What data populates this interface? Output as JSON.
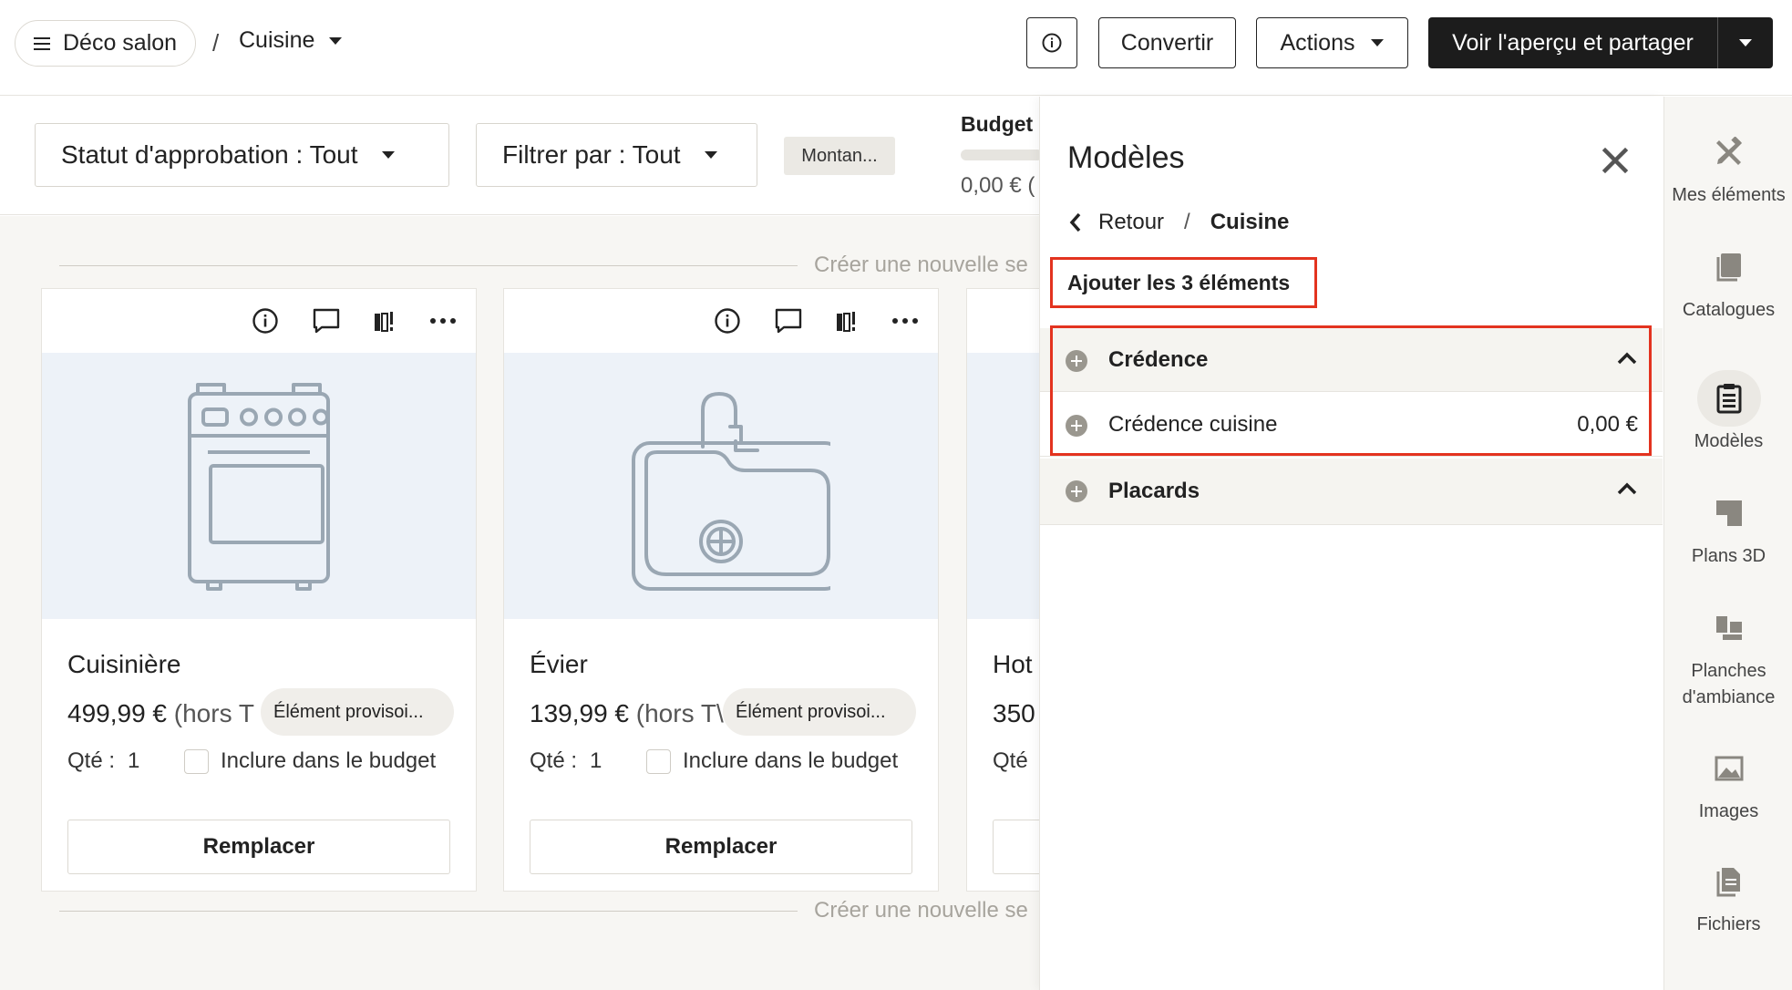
{
  "header": {
    "project_name": "Déco salon",
    "breadcrumb_separator": "/",
    "room": "Cuisine",
    "convert_label": "Convertir",
    "actions_label": "Actions",
    "share_label": "Voir l'aperçu et partager"
  },
  "filters": {
    "status_label": "Statut d'approbation : Tout",
    "filter_label": "Filtrer par : Tout",
    "amount_chip": "Montan...",
    "budget_label": "Budget",
    "budget_value": "0,00 € ("
  },
  "content": {
    "new_section_label": "Créer une nouvelle se",
    "new_section_label_bottom": "Créer une nouvelle se",
    "cards": [
      {
        "title": "Cuisinière",
        "price": "499,99 €",
        "price_suffix": "(hors T",
        "badge": "Élément provisoi...",
        "qty_label": "Qté :",
        "qty_value": "1",
        "include_label": "Inclure dans le budget",
        "replace_label": "Remplacer",
        "icon": "stove-icon"
      },
      {
        "title": "Évier",
        "price": "139,99 €",
        "price_suffix": "(hors T\\",
        "badge": "Élément provisoi...",
        "qty_label": "Qté :",
        "qty_value": "1",
        "include_label": "Inclure dans le budget",
        "replace_label": "Remplacer",
        "icon": "sink-icon"
      },
      {
        "title": "Hot",
        "price": "350",
        "qty_label": "Qté"
      }
    ]
  },
  "panel": {
    "title": "Modèles",
    "back_label": "Retour",
    "separator": "/",
    "current": "Cuisine",
    "add_all_label": "Ajouter les 3 éléments",
    "groups": [
      {
        "label": "Crédence",
        "items": [
          {
            "label": "Crédence cuisine",
            "amount": "0,00 €"
          }
        ]
      },
      {
        "label": "Placards"
      }
    ]
  },
  "rail": {
    "items": [
      {
        "label": "Mes éléments",
        "icon": "tools-icon"
      },
      {
        "label": "Catalogues",
        "icon": "catalog-icon"
      },
      {
        "label": "Modèles",
        "icon": "template-icon",
        "active": true
      },
      {
        "label": "Plans 3D",
        "icon": "floorplan-icon"
      },
      {
        "label": "Planches d'ambiance",
        "icon": "moodboard-icon"
      },
      {
        "label": "Images",
        "icon": "image-icon"
      },
      {
        "label": "Fichiers",
        "icon": "files-icon"
      }
    ]
  },
  "colors": {
    "highlight": "#e3331f",
    "primary_dark": "#1c1c1c",
    "image_bg": "#edf2f8",
    "canvas_bg": "#f7f6f3"
  }
}
